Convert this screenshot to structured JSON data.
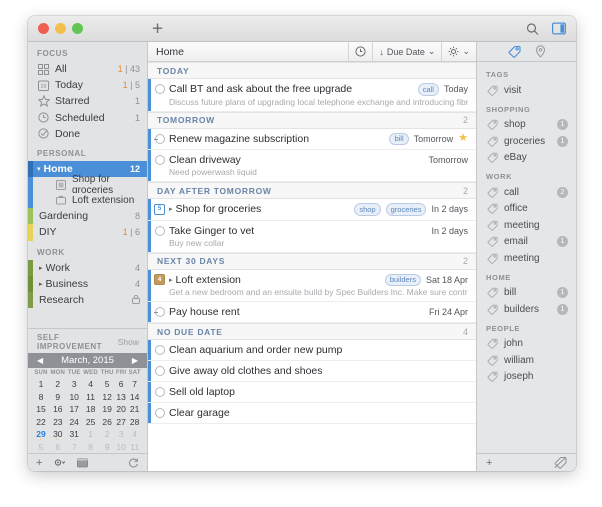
{
  "window": {
    "plus_label": "+",
    "search_icon": "search-icon",
    "panel_icon": "sidebar-toggle-icon"
  },
  "sidebar": {
    "sections": [
      {
        "title": "FOCUS",
        "items": [
          {
            "label": "All",
            "count": "1 | 43",
            "hot": "1",
            "rest": "| 43",
            "icon": "grid-icon",
            "color": ""
          },
          {
            "label": "Today",
            "count": "1 | 5",
            "hot": "1",
            "rest": "| 5",
            "icon": "calendar-icon",
            "color": ""
          },
          {
            "label": "Starred",
            "count": "1",
            "hot": "",
            "rest": "1",
            "icon": "star-icon",
            "color": ""
          },
          {
            "label": "Scheduled",
            "count": "1",
            "hot": "",
            "rest": "1",
            "icon": "clock-icon",
            "color": ""
          },
          {
            "label": "Done",
            "count": "",
            "hot": "",
            "rest": "",
            "icon": "check-circle-icon",
            "color": ""
          }
        ]
      },
      {
        "title": "PERSONAL",
        "items": [
          {
            "label": "Home",
            "count": "12",
            "hot": "",
            "rest": "12",
            "icon": "",
            "color": "#4a8fd8",
            "selected": true,
            "expanded": true
          },
          {
            "label": "Gardening",
            "count": "8",
            "hot": "",
            "rest": "8",
            "icon": "",
            "color": "#9cc25c"
          },
          {
            "label": "DIY",
            "count": "1 | 6",
            "hot": "1",
            "rest": "| 6",
            "icon": "",
            "color": "#e8d35a"
          }
        ]
      },
      {
        "title": "WORK",
        "items": [
          {
            "label": "Work",
            "count": "4",
            "hot": "",
            "rest": "4",
            "icon": "",
            "color": "#7b9b43",
            "disclosure": true
          },
          {
            "label": "Business",
            "count": "4",
            "hot": "",
            "rest": "4",
            "icon": "",
            "color": "#6f9036",
            "disclosure": true
          },
          {
            "label": "Research",
            "count": "",
            "hot": "",
            "rest": "",
            "icon": "",
            "color": "#7f9b48",
            "lock": true
          }
        ]
      }
    ],
    "home_children": [
      {
        "label": "Shop for groceries",
        "icon": "note-icon"
      },
      {
        "label": "Loft extension",
        "icon": "briefcase-icon"
      }
    ],
    "self_improvement": {
      "title": "SELF IMPROVEMENT",
      "show_label": "Show"
    },
    "footer": {
      "add": "+",
      "gear": "gear-icon",
      "calendar": "calendar-icon",
      "refresh": "refresh-icon"
    }
  },
  "calendar": {
    "month_label": "March, 2015",
    "prev": "◀",
    "next": "▶",
    "weekdays": [
      "SUN",
      "MON",
      "TUE",
      "WED",
      "THU",
      "FRI",
      "SAT"
    ],
    "weeks": [
      [
        {
          "d": "1"
        },
        {
          "d": "2"
        },
        {
          "d": "3"
        },
        {
          "d": "4"
        },
        {
          "d": "5"
        },
        {
          "d": "6"
        },
        {
          "d": "7"
        }
      ],
      [
        {
          "d": "8"
        },
        {
          "d": "9"
        },
        {
          "d": "10"
        },
        {
          "d": "11"
        },
        {
          "d": "12"
        },
        {
          "d": "13"
        },
        {
          "d": "14"
        }
      ],
      [
        {
          "d": "15"
        },
        {
          "d": "16"
        },
        {
          "d": "17"
        },
        {
          "d": "18"
        },
        {
          "d": "19"
        },
        {
          "d": "20"
        },
        {
          "d": "21"
        }
      ],
      [
        {
          "d": "22"
        },
        {
          "d": "23"
        },
        {
          "d": "24"
        },
        {
          "d": "25"
        },
        {
          "d": "26"
        },
        {
          "d": "27"
        },
        {
          "d": "28"
        }
      ],
      [
        {
          "d": "29",
          "today": true,
          "dots": "·"
        },
        {
          "d": "30",
          "dots": "··"
        },
        {
          "d": "31",
          "dots": "···"
        },
        {
          "d": "1",
          "out": true
        },
        {
          "d": "2",
          "out": true
        },
        {
          "d": "3",
          "out": true
        },
        {
          "d": "4",
          "out": true
        }
      ],
      [
        {
          "d": "5",
          "out": true
        },
        {
          "d": "6",
          "out": true
        },
        {
          "d": "7",
          "out": true
        },
        {
          "d": "8",
          "out": true
        },
        {
          "d": "9",
          "out": true
        },
        {
          "d": "10",
          "out": true
        },
        {
          "d": "11",
          "out": true
        }
      ]
    ]
  },
  "main": {
    "title": "Home",
    "clock_icon": "clock-icon",
    "sort_label": "Due Date",
    "sort_arrow": "↓",
    "sort_chevron": "⌄",
    "display_icon": "brightness-icon",
    "display_chevron": "⌄",
    "groups": [
      {
        "title": "TODAY",
        "count": "",
        "tasks": [
          {
            "title": "Call BT and ask about the free upgrade",
            "note": "Discuss future plans of upgrading local telephone exchange and introducing fibre",
            "tags": [
              "call"
            ],
            "when": "Today",
            "marker": "circle",
            "starred": false
          }
        ]
      },
      {
        "title": "TOMORROW",
        "count": "2",
        "tasks": [
          {
            "title": "Renew magazine subscription",
            "note": "",
            "tags": [
              "bill"
            ],
            "when": "Tomorrow",
            "marker": "recurring",
            "starred": true
          },
          {
            "title": "Clean driveway",
            "note": "Need powerwash liquid",
            "tags": [],
            "when": "Tomorrow",
            "marker": "circle",
            "starred": false
          }
        ]
      },
      {
        "title": "DAY AFTER TOMORROW",
        "count": "2",
        "tasks": [
          {
            "title": "Shop for groceries",
            "note": "",
            "tags": [
              "shop",
              "groceries"
            ],
            "when": "In 2 days",
            "marker": "badge-blue",
            "badge_text": "5",
            "disclosure": true,
            "starred": false
          },
          {
            "title": "Take Ginger to vet",
            "note": "Buy new collar",
            "tags": [],
            "when": "In 2 days",
            "marker": "circle",
            "starred": false
          }
        ]
      },
      {
        "title": "NEXT 30 DAYS",
        "count": "2",
        "tasks": [
          {
            "title": "Loft extension",
            "note": "Get a new bedroom and an ensuite build by Spec Builders Inc. Make sure contract covers roo",
            "tags": [
              "builders"
            ],
            "when": "Sat 18 Apr",
            "marker": "badge-brown",
            "badge_text": "4",
            "disclosure": true,
            "starred": false
          },
          {
            "title": "Pay house rent",
            "note": "",
            "tags": [],
            "when": "Fri 24 Apr",
            "marker": "recurring",
            "starred": false
          }
        ]
      },
      {
        "title": "NO DUE DATE",
        "count": "4",
        "tasks": [
          {
            "title": "Clean aquarium and order new pump",
            "note": "",
            "tags": [],
            "when": "",
            "marker": "circle",
            "starred": false
          },
          {
            "title": "Give away old clothes and shoes",
            "note": "",
            "tags": [],
            "when": "",
            "marker": "circle",
            "starred": false
          },
          {
            "title": "Sell old laptop",
            "note": "",
            "tags": [],
            "when": "",
            "marker": "circle",
            "starred": false
          },
          {
            "title": "Clear garage",
            "note": "",
            "tags": [],
            "when": "",
            "marker": "circle",
            "starred": false
          }
        ]
      }
    ]
  },
  "tags_panel": {
    "tag_icon": "tag-icon",
    "location_icon": "location-pin-icon",
    "sections": [
      {
        "title": "TAGS",
        "items": [
          {
            "label": "visit",
            "count": ""
          }
        ]
      },
      {
        "title": "SHOPPING",
        "items": [
          {
            "label": "shop",
            "count": "1"
          },
          {
            "label": "groceries",
            "count": "1"
          },
          {
            "label": "eBay",
            "count": ""
          }
        ]
      },
      {
        "title": "WORK",
        "items": [
          {
            "label": "call",
            "count": "2"
          },
          {
            "label": "office",
            "count": ""
          },
          {
            "label": "meeting",
            "count": ""
          },
          {
            "label": "email",
            "count": "1"
          },
          {
            "label": "meeting",
            "count": ""
          }
        ]
      },
      {
        "title": "HOME",
        "items": [
          {
            "label": "bill",
            "count": "1"
          },
          {
            "label": "builders",
            "count": "1"
          }
        ]
      },
      {
        "title": "PEOPLE",
        "items": [
          {
            "label": "john",
            "count": ""
          },
          {
            "label": "william",
            "count": ""
          },
          {
            "label": "joseph",
            "count": ""
          }
        ]
      }
    ],
    "footer": {
      "add": "+",
      "clear": "clear-tag-icon"
    }
  }
}
